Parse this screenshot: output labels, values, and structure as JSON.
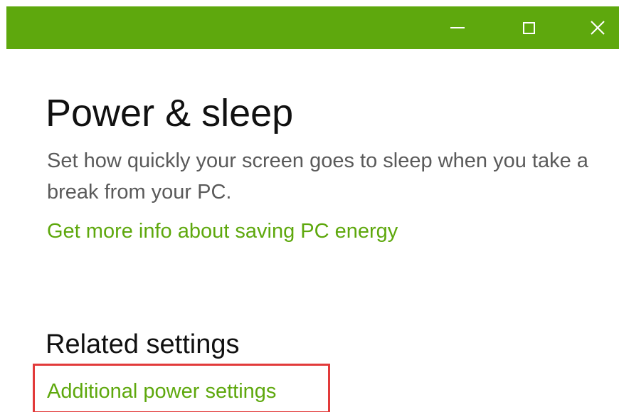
{
  "window": {
    "accent_color": "#5ea80d",
    "titlebar_icons": {
      "minimize": "minimize-icon",
      "maximize": "maximize-icon",
      "close": "close-icon"
    }
  },
  "page": {
    "title": "Power & sleep",
    "description": "Set how quickly your screen goes to sleep when you take a break from your PC.",
    "info_link": "Get more info about saving PC energy"
  },
  "related": {
    "heading": "Related settings",
    "items": [
      {
        "label": "Additional power settings",
        "highlighted": true,
        "highlight_color": "#e23a3a"
      }
    ]
  }
}
